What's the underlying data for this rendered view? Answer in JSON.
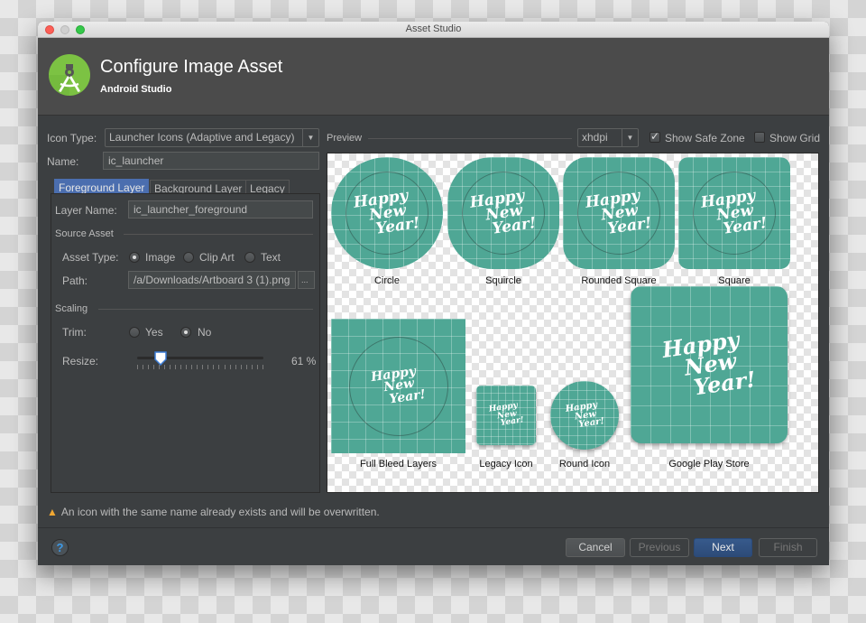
{
  "window": {
    "title": "Asset Studio"
  },
  "header": {
    "title": "Configure Image Asset",
    "subtitle": "Android Studio",
    "logo": "android-studio-logo"
  },
  "form": {
    "icon_type_label": "Icon Type:",
    "icon_type_value": "Launcher Icons (Adaptive and Legacy)",
    "name_label": "Name:",
    "name_value": "ic_launcher"
  },
  "tabs": [
    {
      "label": "Foreground Layer",
      "active": true
    },
    {
      "label": "Background Layer",
      "active": false
    },
    {
      "label": "Legacy",
      "active": false
    }
  ],
  "layer": {
    "layer_name_label": "Layer Name:",
    "layer_name_value": "ic_launcher_foreground",
    "source_asset_title": "Source Asset",
    "asset_type_label": "Asset Type:",
    "asset_type_options": [
      {
        "label": "Image",
        "checked": true
      },
      {
        "label": "Clip Art",
        "checked": false
      },
      {
        "label": "Text",
        "checked": false
      }
    ],
    "path_label": "Path:",
    "path_value": "/a/Downloads/Artboard 3 (1).png",
    "browse_label": "...",
    "scaling_title": "Scaling",
    "trim_label": "Trim:",
    "trim_options": [
      {
        "label": "Yes",
        "checked": false
      },
      {
        "label": "No",
        "checked": true
      }
    ],
    "resize_label": "Resize:",
    "resize_percent": 61,
    "resize_text": "61 %"
  },
  "preview": {
    "label": "Preview",
    "density": "xhdpi",
    "show_safe_zone_label": "Show Safe Zone",
    "show_safe_zone": true,
    "show_grid_label": "Show Grid",
    "show_grid": false,
    "icon_text": [
      "Happy",
      "New",
      "Year!"
    ],
    "icon_color": "#4fa795",
    "captions": {
      "circle": "Circle",
      "squircle": "Squircle",
      "rounded_square": "Rounded Square",
      "square": "Square",
      "full_bleed": "Full Bleed Layers",
      "legacy": "Legacy Icon",
      "round": "Round Icon",
      "play_store": "Google Play Store"
    }
  },
  "warning": {
    "text": "An icon with the same name already exists and will be overwritten."
  },
  "buttons": {
    "help": "?",
    "cancel": "Cancel",
    "previous": "Previous",
    "next": "Next",
    "finish": "Finish"
  }
}
